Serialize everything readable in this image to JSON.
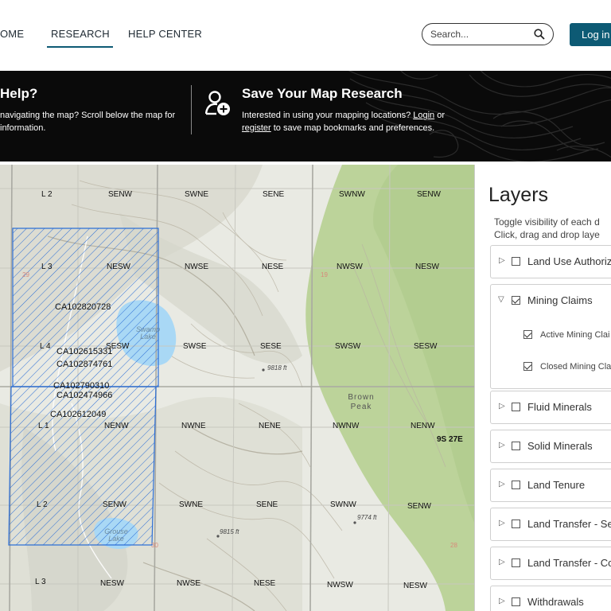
{
  "nav": {
    "home": "OME",
    "research": "RESEARCH",
    "help_center": "HELP CENTER",
    "search_placeholder": "Search...",
    "login": "Log in"
  },
  "banner": {
    "help_title": "Help?",
    "help_text_1": " navigating the map? Scroll below the map for",
    "help_text_2": " information.",
    "save_title": "Save Your Map Research",
    "save_text_1": "Interested in using your mapping locations? ",
    "save_login": "Login",
    "save_text_2": " or",
    "save_register": "register",
    "save_text_3": " to save map bookmarks and preferences."
  },
  "map": {
    "sections": [
      {
        "label": "L 2"
      },
      {
        "label": "SENW"
      },
      {
        "label": "SWNE"
      },
      {
        "label": "SENE"
      },
      {
        "label": "SWNW"
      },
      {
        "label": "SENW"
      },
      {
        "label": "L 3"
      },
      {
        "label": "NESW"
      },
      {
        "label": "NWSE"
      },
      {
        "label": "NESE"
      },
      {
        "label": "NWSW"
      },
      {
        "label": "NESW"
      },
      {
        "label": "L 4"
      },
      {
        "label": "SESW"
      },
      {
        "label": "SWSE"
      },
      {
        "label": "SESE"
      },
      {
        "label": "SWSW"
      },
      {
        "label": "SESW"
      },
      {
        "label": "L 1"
      },
      {
        "label": "NENW"
      },
      {
        "label": "NWNE"
      },
      {
        "label": "NENE"
      },
      {
        "label": "NWNW"
      },
      {
        "label": "NENW"
      },
      {
        "label": "L 2"
      },
      {
        "label": "SENW"
      },
      {
        "label": "SWNE"
      },
      {
        "label": "SENE"
      },
      {
        "label": "SWNW"
      },
      {
        "label": "SENW"
      },
      {
        "label": "L 3"
      },
      {
        "label": "NESW"
      },
      {
        "label": "NWSE"
      },
      {
        "label": "NESE"
      },
      {
        "label": "NWSW"
      },
      {
        "label": "NESW"
      }
    ],
    "claims": [
      "CA102820728",
      "CA102615331",
      "CA102874761",
      "CA102790310",
      "CA102474966",
      "CA102612049"
    ],
    "lakes": [
      "Swamp Lake",
      "Grouse Lake"
    ],
    "peak": "Brown Peak",
    "elevations": [
      "9818 ft",
      "9815 ft",
      "9774 ft"
    ],
    "township": "9S 27E",
    "red_numbers": [
      "19",
      "30",
      "29",
      "28"
    ]
  },
  "layers_panel": {
    "title": "Layers",
    "desc_1": "Toggle visibility of each d",
    "desc_2": "Click, drag and drop laye",
    "layers": [
      {
        "label": "Land Use Authoriz",
        "checked": false,
        "expanded": false
      },
      {
        "label": "Mining Claims",
        "checked": true,
        "expanded": true
      },
      {
        "label": "Fluid Minerals",
        "checked": false,
        "expanded": false
      },
      {
        "label": "Solid Minerals",
        "checked": false,
        "expanded": false
      },
      {
        "label": "Land Tenure",
        "checked": false,
        "expanded": false
      },
      {
        "label": "Land Transfer - Sel",
        "checked": false,
        "expanded": false
      },
      {
        "label": "Land Transfer - Co",
        "checked": false,
        "expanded": false
      },
      {
        "label": "Withdrawals",
        "checked": false,
        "expanded": false
      }
    ],
    "sublayers": [
      {
        "label": "Active Mining Clai",
        "checked": true
      },
      {
        "label": "Closed Mining Cla",
        "checked": true
      }
    ]
  },
  "colors": {
    "brand": "#0d5a74",
    "claim_outline": "#2d6fd6",
    "forest": "#bcd39a",
    "lake": "#a9d8f5"
  }
}
